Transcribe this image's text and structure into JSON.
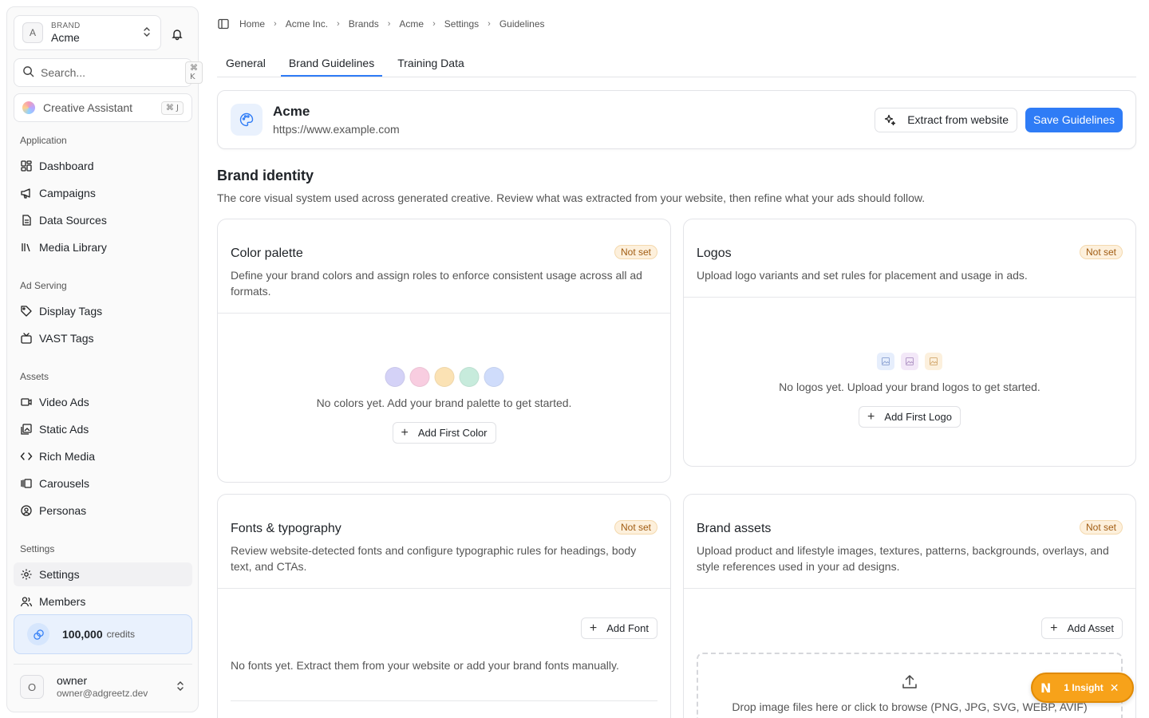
{
  "sidebar": {
    "brand_label": "BRAND",
    "brand_name": "Acme",
    "brand_initial": "A",
    "search_placeholder": "Search...",
    "search_shortcut": "⌘ K",
    "assistant_label": "Creative Assistant",
    "assistant_shortcut": "⌘ J",
    "sections": {
      "application": "Application",
      "ad_serving": "Ad Serving",
      "assets": "Assets",
      "settings": "Settings"
    },
    "items": {
      "dashboard": "Dashboard",
      "campaigns": "Campaigns",
      "data_sources": "Data Sources",
      "media_library": "Media Library",
      "display_tags": "Display Tags",
      "vast_tags": "VAST Tags",
      "video_ads": "Video Ads",
      "static_ads": "Static Ads",
      "rich_media": "Rich Media",
      "carousels": "Carousels",
      "personas": "Personas",
      "settings": "Settings",
      "members": "Members"
    },
    "credits_value": "100,000",
    "credits_unit": "credits",
    "user_initial": "O",
    "user_name": "owner",
    "user_email": "owner@adgreetz.dev"
  },
  "breadcrumb": [
    "Home",
    "Acme Inc.",
    "Brands",
    "Acme",
    "Settings",
    "Guidelines"
  ],
  "tabs": [
    "General",
    "Brand Guidelines",
    "Training Data"
  ],
  "active_tab": "Brand Guidelines",
  "brand_header": {
    "name": "Acme",
    "url": "https://www.example.com",
    "extract_label": "Extract from website",
    "save_label": "Save Guidelines"
  },
  "identity": {
    "title": "Brand identity",
    "description": "The core visual system used across generated creative. Review what was extracted from your website, then refine what your ads should follow."
  },
  "cards": {
    "colors": {
      "title": "Color palette",
      "badge": "Not set",
      "description": "Define your brand colors and assign roles to enforce consistent usage across all ad formats.",
      "empty": "No colors yet. Add your brand palette to get started.",
      "button": "Add First Color",
      "placeholder_colors": [
        "#d4d2f7",
        "#f8cde0",
        "#fbe2b4",
        "#c7ebdc",
        "#cfdcfb"
      ]
    },
    "logos": {
      "title": "Logos",
      "badge": "Not set",
      "description": "Upload logo variants and set rules for placement and usage in ads.",
      "empty": "No logos yet. Upload your brand logos to get started.",
      "button": "Add First Logo"
    },
    "fonts": {
      "title": "Fonts & typography",
      "badge": "Not set",
      "description": "Review website-detected fonts and configure typographic rules for headings, body text, and CTAs.",
      "button": "Add Font",
      "empty": "No fonts yet. Extract them from your website or add your brand fonts manually."
    },
    "assets": {
      "title": "Brand assets",
      "badge": "Not set",
      "description": "Upload product and lifestyle images, textures, patterns, backgrounds, overlays, and style references used in your ad designs.",
      "button": "Add Asset",
      "dropzone": "Drop image files here or click to browse (PNG, JPG, SVG, WEBP, AVIF)"
    }
  },
  "insight": {
    "icon": "N",
    "label": "1 Insight"
  },
  "colors": {
    "accent": "#2f7cf6",
    "badge_bg": "#fdf0dc",
    "badge_text": "#a15c12",
    "insight": "#f7a21a"
  }
}
